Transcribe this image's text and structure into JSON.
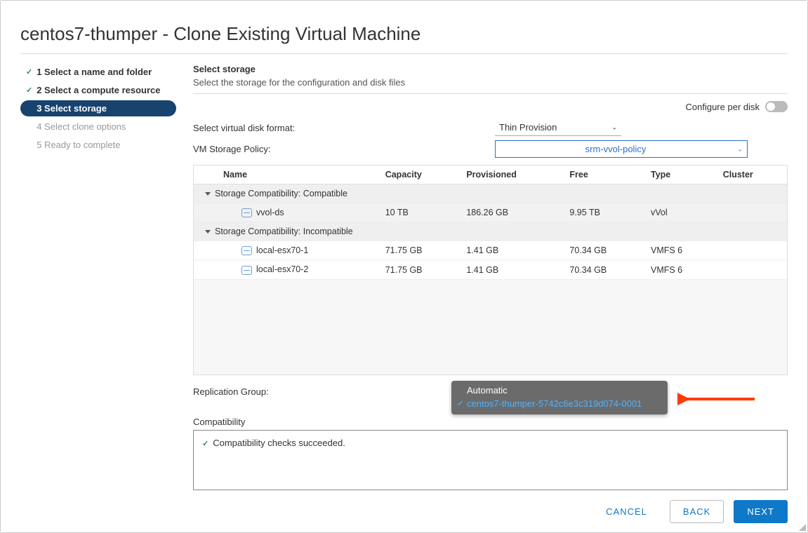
{
  "dialog": {
    "title": "centos7-thumper - Clone Existing Virtual Machine"
  },
  "steps": {
    "s1": "1 Select a name and folder",
    "s2": "2 Select a compute resource",
    "s3": "3 Select storage",
    "s4": "4 Select clone options",
    "s5": "5 Ready to complete"
  },
  "section": {
    "title": "Select storage",
    "subtitle": "Select the storage for the configuration and disk files"
  },
  "perdisk": {
    "label": "Configure per disk"
  },
  "disk_format": {
    "label": "Select virtual disk format:",
    "value": "Thin Provision"
  },
  "storage_policy": {
    "label": "VM Storage Policy:",
    "value": "srm-vvol-policy"
  },
  "table": {
    "headers": {
      "name": "Name",
      "capacity": "Capacity",
      "provisioned": "Provisioned",
      "free": "Free",
      "type": "Type",
      "cluster": "Cluster"
    },
    "group_compat": "Storage Compatibility: Compatible",
    "group_incompat": "Storage Compatibility: Incompatible",
    "rows": {
      "r0": {
        "name": "vvol-ds",
        "capacity": "10 TB",
        "provisioned": "186.26 GB",
        "free": "9.95 TB",
        "type": "vVol",
        "cluster": ""
      },
      "r1": {
        "name": "local-esx70-1",
        "capacity": "71.75 GB",
        "provisioned": "1.41 GB",
        "free": "70.34 GB",
        "type": "VMFS 6",
        "cluster": ""
      },
      "r2": {
        "name": "local-esx70-2",
        "capacity": "71.75 GB",
        "provisioned": "1.41 GB",
        "free": "70.34 GB",
        "type": "VMFS 6",
        "cluster": ""
      }
    }
  },
  "replication": {
    "label": "Replication Group:",
    "options": {
      "o0": "Automatic",
      "o1": "centos7-thumper-5742c6e3c319d074-0001"
    }
  },
  "compat": {
    "label": "Compatibility",
    "msg": "Compatibility checks succeeded."
  },
  "footer": {
    "cancel": "CANCEL",
    "back": "BACK",
    "next": "NEXT"
  }
}
